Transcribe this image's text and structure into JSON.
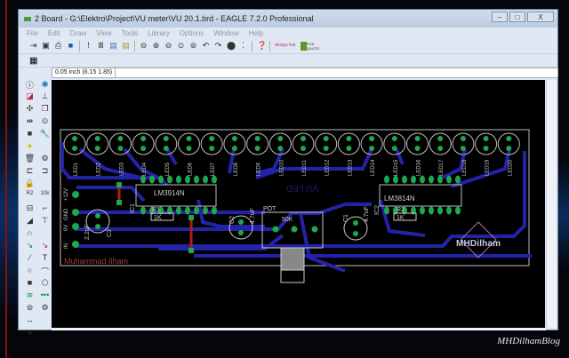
{
  "window": {
    "title": "2 Board - G:\\Elektro\\Project\\VU meter\\VU 20.1.brd - EAGLE 7.2.0 Professional",
    "minimize": "–",
    "maximize": "□",
    "close": "X"
  },
  "menu": [
    "File",
    "Edit",
    "Draw",
    "View",
    "Tools",
    "Library",
    "Options",
    "Window",
    "Help"
  ],
  "coord_readout": "0.05 inch (6.15 1.85)",
  "toolbar": {
    "design_link": "design link",
    "pcb_quote": "PCB QUOTE"
  },
  "board": {
    "leds": [
      "LED1",
      "LED2",
      "LED3",
      "LED4",
      "LED5",
      "LED6",
      "LED7",
      "LED8",
      "LED9",
      "LED10",
      "LED11",
      "LED12",
      "LED13",
      "LED14",
      "LED15",
      "LED16",
      "LED17",
      "LED18",
      "LED19",
      "LED20"
    ],
    "ic1_name": "IC1",
    "ic1_value": "LM3914N",
    "ic2_name": "IC2",
    "ic2_value": "LM3814N",
    "r1_name": "R1",
    "r1_value": "1K",
    "r2_name": "R2",
    "r2_value": "1K",
    "c1_name": "C1",
    "c1_value": "4.7uF",
    "c2_name": "C2",
    "c2_value": "4.7uF",
    "c3_name": "C3",
    "c3_value": "2.2uF",
    "pot_name": "POT",
    "pot_value": "50K",
    "pins": [
      "+12V",
      "GND",
      "0V",
      "IN"
    ],
    "mirror_text": "VU LED",
    "author": "Muhammad Ilham",
    "logo_text": "MHDilham"
  },
  "watermark": "MHDilhamBlog",
  "colors": {
    "trace": "#2323a8",
    "pad": "#1fa84a",
    "silk": "#c8c8c8",
    "wire": "#b01c1c",
    "author": "#a03a3a"
  }
}
